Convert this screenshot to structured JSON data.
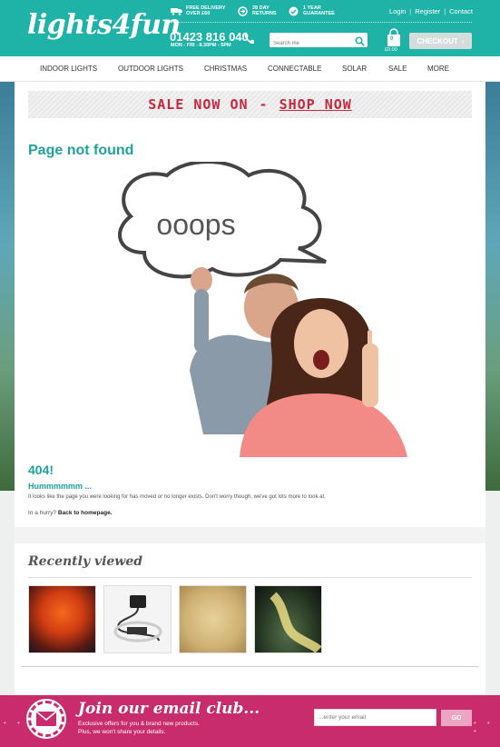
{
  "header": {
    "logo": "lights4fun",
    "usps": [
      {
        "icon": "delivery-truck-icon",
        "line1": "FREE DELIVERY",
        "line2": "OVER £60"
      },
      {
        "icon": "returns-icon",
        "line1": "28 DAY",
        "line2": "RETURNS"
      },
      {
        "icon": "guarantee-check-icon",
        "line1": "1 YEAR",
        "line2": "GUARANTEE"
      }
    ],
    "top_links": [
      "Login",
      "Register",
      "Contact"
    ],
    "phone": "01423 816 040",
    "hours": "MON - FRI - 8.30PM - 5PM",
    "search_placeholder": "Search me",
    "basket_count": "0",
    "basket_total": "£0.00",
    "checkout_label": "CHECKOUT",
    "accent_color": "#1fb3a8"
  },
  "nav": {
    "items": [
      "INDOOR LIGHTS",
      "OUTDOOR LIGHTS",
      "CHRISTMAS",
      "CONNECTABLE",
      "SOLAR",
      "SALE",
      "MORE"
    ]
  },
  "banner": {
    "left": "SALE NOW ON",
    "dash": "-",
    "right": "SHOP NOW",
    "color": "#c8283f"
  },
  "error": {
    "title": "Page not found",
    "bubble_text": "ooops",
    "code": "404!",
    "subtitle": "Hummmmmm ...",
    "body": "It looks like the page you were looking for has moved or no longer exists. Don't worry though, we've got lots more to look at.",
    "hurry_prefix": "In a hurry?",
    "home_link": "Back to homepage."
  },
  "recently_viewed": {
    "title": "Recently viewed",
    "items": [
      {
        "alt": "orange-lit-tree"
      },
      {
        "alt": "cable-and-controller"
      },
      {
        "alt": "net-lights"
      },
      {
        "alt": "path-lights"
      }
    ]
  },
  "email_club": {
    "title": "Join our email club...",
    "line1": "Exclusive offers for you & brand new products.",
    "line2": "Plus, we won't share your details.",
    "placeholder": "...enter your email",
    "button": "GO",
    "color": "#c92c6d"
  }
}
